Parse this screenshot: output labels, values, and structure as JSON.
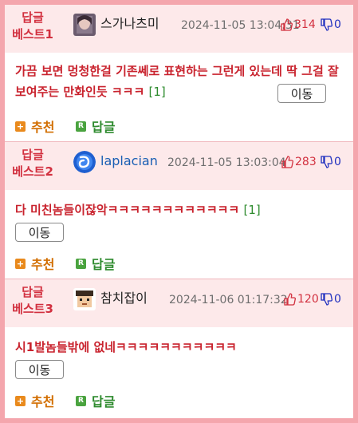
{
  "replies": [
    {
      "rank_line1": "답글",
      "rank_line2": "베스트1",
      "nickname": "스가나츠미",
      "date": "2024-11-05 13:04:31",
      "upvotes": "314",
      "downvotes": "0",
      "text": "가끔 보면 멍청한걸 기존쎄로 표현하는 그런게 있는데 딱 그걸 잘 보여주는 만화인듯 ㅋㅋㅋ",
      "count": "[1]",
      "move_label": "이동",
      "recommend_label": "추천",
      "reply_label": "답글"
    },
    {
      "rank_line1": "답글",
      "rank_line2": "베스트2",
      "nickname": "laplacian",
      "date": "2024-11-05 13:03:04",
      "upvotes": "283",
      "downvotes": "0",
      "text": "다 미친놈들이잖악ㅋㅋㅋㅋㅋㅋㅋㅋㅋㅋㅋㅋ",
      "count": "[1]",
      "move_label": "이동",
      "recommend_label": "추천",
      "reply_label": "답글"
    },
    {
      "rank_line1": "답글",
      "rank_line2": "베스트3",
      "nickname": "참치잡이",
      "date": "2024-11-06 01:17:32",
      "upvotes": "120",
      "downvotes": "0",
      "text": "시1발놈들밖에 없네ㅋㅋㅋㅋㅋㅋㅋㅋㅋㅋㅋ",
      "count": "",
      "move_label": "이동",
      "recommend_label": "추천",
      "reply_label": "답글"
    }
  ],
  "colors": {
    "frame": "#f4a6ad",
    "header_bg": "#fde9ea",
    "rank_text": "#d2303f",
    "comment_text": "#c9232e",
    "recommend": "#d26e00",
    "reply": "#2e8b2e",
    "downvote": "#1f2fbf"
  },
  "icons": {
    "upvote": "thumbs-up-icon",
    "downvote": "thumbs-down-icon",
    "recommend": "plus-square-icon",
    "reply": "r-square-icon"
  }
}
